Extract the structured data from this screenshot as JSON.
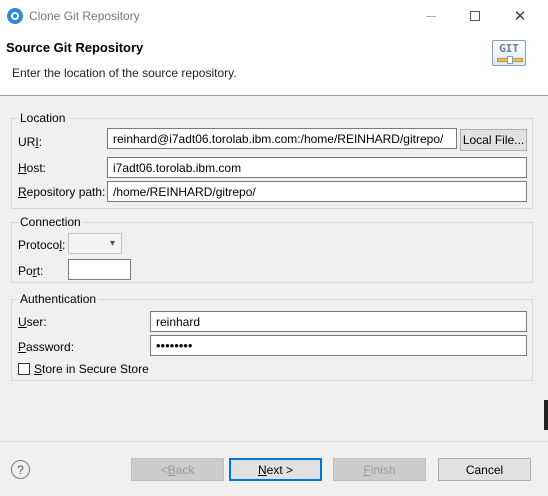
{
  "window": {
    "title": "Clone Git Repository"
  },
  "banner": {
    "title": "Source Git Repository",
    "description": "Enter the location of the source repository.",
    "icon_text": "GIT"
  },
  "location": {
    "group_label": "Location",
    "uri_label": "URI:",
    "uri_value": "reinhard@i7adt06.torolab.ibm.com:/home/REINHARD/gitrepo/",
    "local_file_label": "Local File...",
    "host_label": "Host:",
    "host_value": "i7adt06.torolab.ibm.com",
    "repo_path_label": "Repository path:",
    "repo_path_value": "/home/REINHARD/gitrepo/"
  },
  "connection": {
    "group_label": "Connection",
    "protocol_label": "Protocol:",
    "protocol_value": "",
    "port_label": "Port:",
    "port_value": ""
  },
  "authentication": {
    "group_label": "Authentication",
    "user_label": "User:",
    "user_value": "reinhard",
    "password_label": "Password:",
    "password_value": "••••••••",
    "store_label": "Store in Secure Store",
    "store_checked": false
  },
  "footer": {
    "help_icon": "?",
    "back_label": "< Back",
    "next_label": "Next >",
    "finish_label": "Finish",
    "cancel_label": "Cancel"
  },
  "icons": {
    "app": "eclipse-clone-icon",
    "banner": "git-icon",
    "dropdown": "chevron-down-icon",
    "help": "help-icon",
    "close": "close-icon",
    "maximize": "maximize-icon",
    "minimize": "minimize-icon"
  },
  "colors": {
    "accent": "#0078d7",
    "window_bg": "#f0f0f0",
    "disabled_text": "#9a9a9a"
  }
}
